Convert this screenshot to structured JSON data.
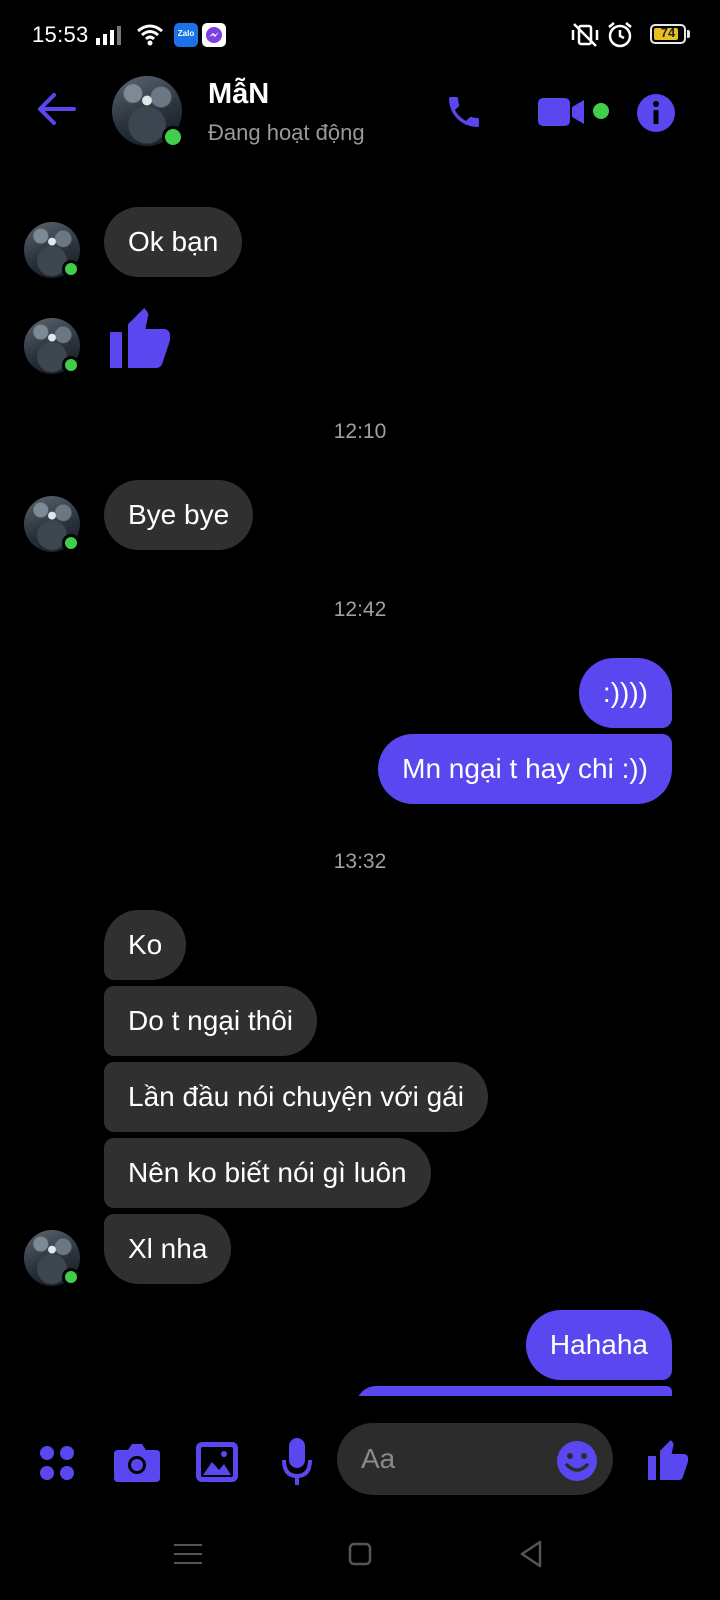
{
  "status_bar": {
    "time": "15:53",
    "battery_level": "74",
    "notification_apps": [
      "Zalo",
      "Messenger"
    ]
  },
  "header": {
    "contact_name": "MẫN",
    "contact_status": "Đang hoạt động"
  },
  "messages": [
    {
      "side": "in",
      "text": "Ok bạn"
    },
    {
      "side": "in",
      "type": "like"
    },
    {
      "type": "timestamp",
      "text": "12:10"
    },
    {
      "side": "in",
      "text": "Bye bye"
    },
    {
      "type": "timestamp",
      "text": "12:42"
    },
    {
      "side": "out",
      "text": ":))))"
    },
    {
      "side": "out",
      "text": "Mn ngại t hay chi :))"
    },
    {
      "type": "timestamp",
      "text": "13:32"
    },
    {
      "side": "in",
      "text": "Ko"
    },
    {
      "side": "in",
      "text": "Do t ngại thôi"
    },
    {
      "side": "in",
      "text": "Lần đầu nói chuyện với gái"
    },
    {
      "side": "in",
      "text": "Nên ko biết nói gì luôn"
    },
    {
      "side": "in",
      "text": "Xl nha"
    },
    {
      "side": "out",
      "text": "Hahaha"
    }
  ],
  "composer": {
    "placeholder": "Aa"
  },
  "colors": {
    "accent": "#5a47f0",
    "incoming_bubble": "#303030",
    "presence": "#3fcf4d",
    "background": "#000000"
  },
  "icons": {
    "header": [
      "back-arrow-icon",
      "phone-icon",
      "video-camera-icon",
      "info-icon"
    ],
    "composer": [
      "menu-dots-icon",
      "camera-icon",
      "gallery-icon",
      "microphone-icon",
      "emoji-icon",
      "like-icon"
    ],
    "nav": [
      "menu-icon",
      "home-icon",
      "back-icon"
    ]
  }
}
